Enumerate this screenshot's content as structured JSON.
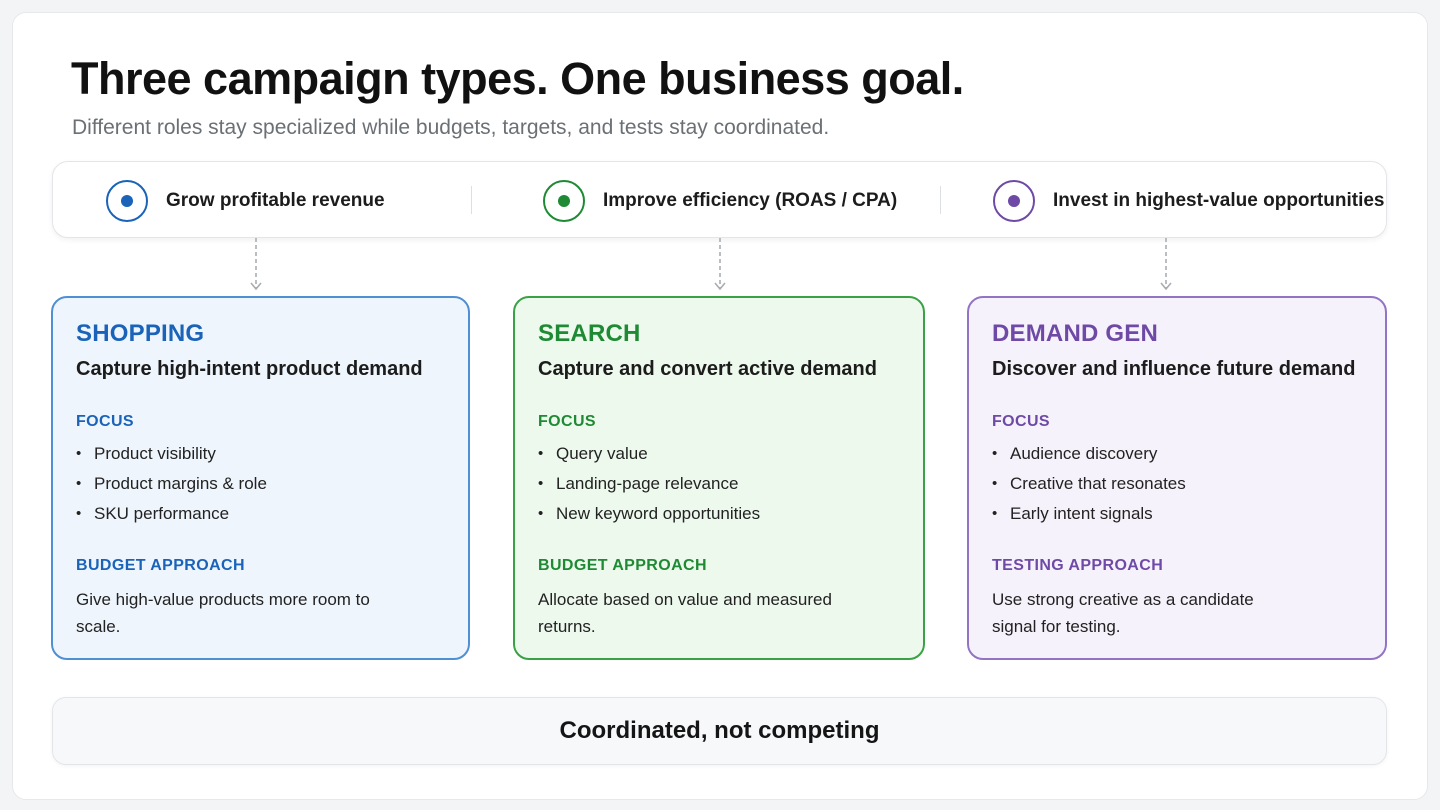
{
  "header": {
    "title": "Three campaign types. One business goal.",
    "subtitle": "Different roles stay specialized while budgets, targets, and tests stay coordinated."
  },
  "goals": [
    {
      "label": "Grow profitable revenue",
      "color": "#1a63b8"
    },
    {
      "label": "Improve efficiency (ROAS / CPA)",
      "color": "#1f8a34"
    },
    {
      "label": "Invest in highest-value opportunities",
      "color": "#6e4aa6"
    }
  ],
  "cards": [
    {
      "name": "SHOPPING",
      "tagline": "Capture high-intent product demand",
      "focus_label": "FOCUS",
      "focus": [
        "Product visibility",
        "Product margins & role",
        "SKU performance"
      ],
      "approach_label": "BUDGET APPROACH",
      "approach_text": "Give high-value products more room to scale.",
      "accent": "#1a63b8"
    },
    {
      "name": "SEARCH",
      "tagline": "Capture and convert active demand",
      "focus_label": "FOCUS",
      "focus": [
        "Query value",
        "Landing-page relevance",
        "New keyword opportunities"
      ],
      "approach_label": "BUDGET APPROACH",
      "approach_text": "Allocate based on value and measured returns.",
      "accent": "#1f8a34"
    },
    {
      "name": "DEMAND GEN",
      "tagline": "Discover and influence future demand",
      "focus_label": "FOCUS",
      "focus": [
        "Audience discovery",
        "Creative that resonates",
        "Early intent signals"
      ],
      "approach_label": "TESTING APPROACH",
      "approach_text": "Use strong creative as a candidate signal for testing.",
      "accent": "#6e4aa6"
    }
  ],
  "footer": {
    "label": "Coordinated, not competing"
  }
}
